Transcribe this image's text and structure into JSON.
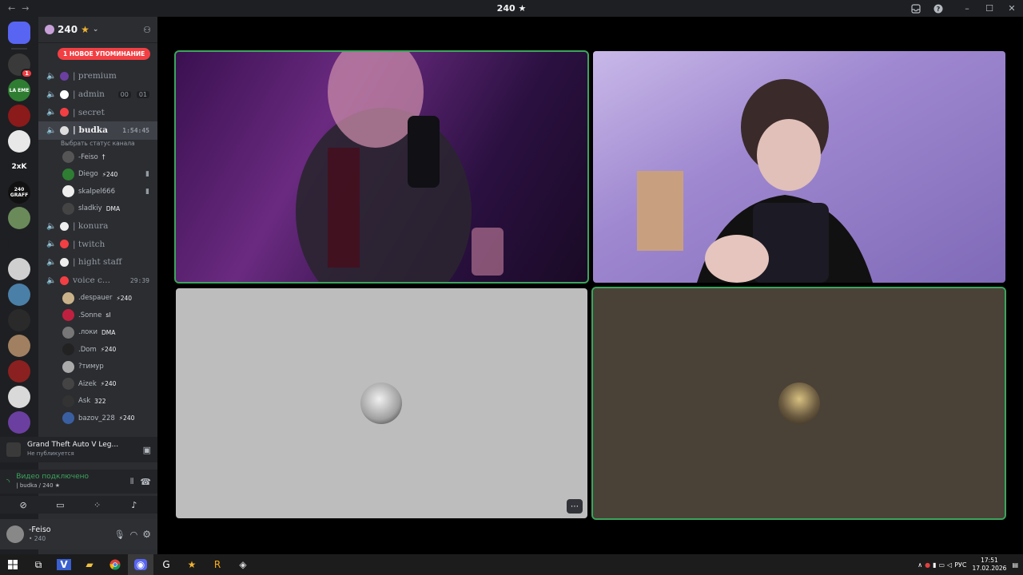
{
  "window": {
    "back": "←",
    "forward": "→",
    "title": "240 ★",
    "inbox_icon": "inbox-icon",
    "help_icon": "help-icon",
    "minimize": "–",
    "maximize": "☐",
    "close": "✕"
  },
  "server": {
    "name": "240",
    "star": "★",
    "mention_pill": "1 НОВОЕ УПОМИНАНИЕ"
  },
  "guilds": [
    {
      "label": "",
      "color": "#5865f2",
      "icon": "discord-home-icon"
    },
    {
      "label": "",
      "color": "#3a3a3a",
      "badge": "1"
    },
    {
      "label": "LA EME",
      "color": "#2e7d32"
    },
    {
      "label": "",
      "color": "#8b1a1a"
    },
    {
      "label": "",
      "color": "#e8e8e8"
    },
    {
      "label": "2xK",
      "color": "#1e1f22"
    },
    {
      "label": "240 GRAFF",
      "color": "#111111"
    },
    {
      "label": "",
      "color": "#6a8a5a"
    },
    {
      "label": "",
      "color": "#1e1f22"
    },
    {
      "label": "",
      "color": "#cfcfcf"
    },
    {
      "label": "",
      "color": "#4a7fa7"
    },
    {
      "label": "",
      "color": "#2a2a2a"
    },
    {
      "label": "",
      "color": "#a08060"
    },
    {
      "label": "",
      "color": "#8b2020"
    },
    {
      "label": "",
      "color": "#d9d9d9"
    },
    {
      "label": "",
      "color": "#6b3fa0"
    }
  ],
  "channels": [
    {
      "name": "| premium",
      "color": "#6b3fa0"
    },
    {
      "name": "| admin",
      "color": "#ffffff",
      "counts": [
        "00",
        "01"
      ]
    },
    {
      "name": "| secret",
      "color": "#f23f43"
    },
    {
      "name": "| budka",
      "color": "#dddddd",
      "time": "1:54:45",
      "active": true,
      "status": "Выбрать статус канала"
    }
  ],
  "budka_members": [
    {
      "name": "-Feiso",
      "tag": "†",
      "color": "#555555"
    },
    {
      "name": "Diego",
      "tag": "⚡240",
      "color": "#2e7d32",
      "right": "▮"
    },
    {
      "name": "skalpel666",
      "tag": "",
      "color": "#eeeeee",
      "right": "▮"
    },
    {
      "name": "sladkiy",
      "tag": "DMA",
      "color": "#444444"
    }
  ],
  "channels2": [
    {
      "name": "| konura",
      "color": "#eeeeee"
    },
    {
      "name": "| twitch",
      "color": "#f23f43"
    },
    {
      "name": "| hight staff",
      "color": "#eeeeee"
    },
    {
      "name": "voice c...",
      "color": "#f23f43",
      "time": "29:39"
    }
  ],
  "voice_members": [
    {
      "name": ".despauer",
      "tag": "⚡240",
      "color": "#c9b28a"
    },
    {
      "name": ".Sonne",
      "tag": "sl",
      "color": "#c02040"
    },
    {
      "name": ".локи",
      "tag": "DMA",
      "color": "#777777"
    },
    {
      "name": ".Dom",
      "tag": "⚡240",
      "color": "#222222"
    },
    {
      "name": "?тимур",
      "tag": "",
      "color": "#aaaaaa"
    },
    {
      "name": "Aizek",
      "tag": "⚡240",
      "color": "#444444"
    },
    {
      "name": "Ask",
      "tag": "322",
      "color": "#333333"
    },
    {
      "name": "bazov_228",
      "tag": "⚡240",
      "color": "#3a5fa0"
    }
  ],
  "activity": {
    "game": "Grand Theft Auto V Leg...",
    "sub": "Не публикуется"
  },
  "voice": {
    "status": "Видео подключено",
    "channel": "| budka / 240 ★"
  },
  "user": {
    "name": "-Feiso",
    "sub": "• 240"
  },
  "taskbar": {
    "lang": "РУС",
    "time": "17:51",
    "date": "17.02.2026"
  },
  "colors": {
    "speaking": "#3ba55c",
    "tile3_bg": "#bdbdbd",
    "tile4_bg": "#4a4237"
  }
}
